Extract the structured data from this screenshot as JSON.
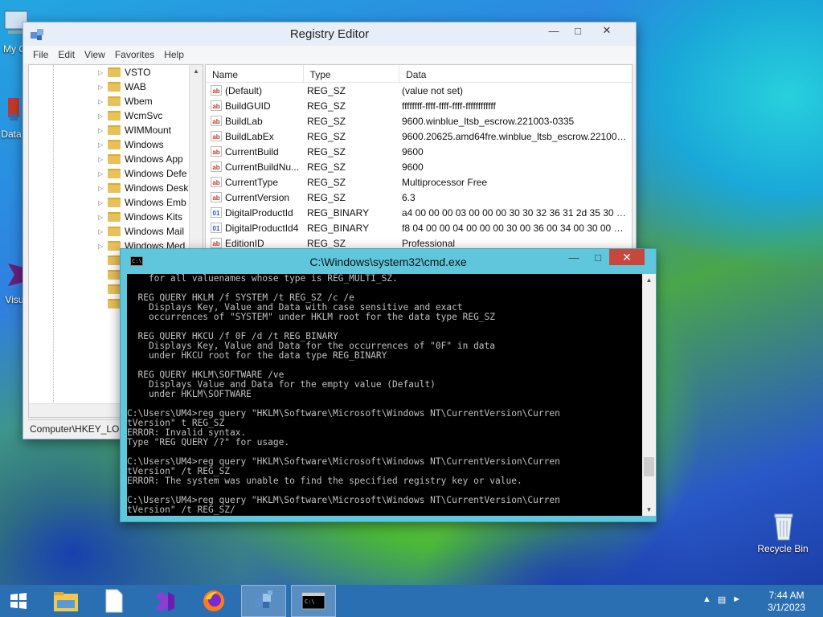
{
  "desktop": {
    "icons": [
      {
        "label": "My C"
      },
      {
        "label": "Data"
      },
      {
        "label": "Visu"
      },
      {
        "label": "Recycle Bin"
      }
    ]
  },
  "regedit": {
    "title": "Registry Editor",
    "menu": [
      "File",
      "Edit",
      "View",
      "Favorites",
      "Help"
    ],
    "tree_items": [
      "VSTO",
      "WAB",
      "Wbem",
      "WcmSvc",
      "WIMMount",
      "Windows",
      "Windows App",
      "Windows Defe",
      "Windows Desk",
      "Windows Emb",
      "Windows Kits",
      "Windows Mail",
      "Windows Med"
    ],
    "columns": [
      "Name",
      "Type",
      "Data"
    ],
    "values": [
      {
        "name": "(Default)",
        "type": "REG_SZ",
        "data": "(value not set)",
        "icon": "string-value-icon"
      },
      {
        "name": "BuildGUID",
        "type": "REG_SZ",
        "data": "ffffffff-ffff-ffff-ffff-ffffffffffff",
        "icon": "string-value-icon"
      },
      {
        "name": "BuildLab",
        "type": "REG_SZ",
        "data": "9600.winblue_ltsb_escrow.221003-0335",
        "icon": "string-value-icon"
      },
      {
        "name": "BuildLabEx",
        "type": "REG_SZ",
        "data": "9600.20625.amd64fre.winblue_ltsb_escrow.221003-...",
        "icon": "string-value-icon"
      },
      {
        "name": "CurrentBuild",
        "type": "REG_SZ",
        "data": "9600",
        "icon": "string-value-icon"
      },
      {
        "name": "CurrentBuildNu...",
        "type": "REG_SZ",
        "data": "9600",
        "icon": "string-value-icon"
      },
      {
        "name": "CurrentType",
        "type": "REG_SZ",
        "data": "Multiprocessor Free",
        "icon": "string-value-icon"
      },
      {
        "name": "CurrentVersion",
        "type": "REG_SZ",
        "data": "6.3",
        "icon": "string-value-icon"
      },
      {
        "name": "DigitalProductId",
        "type": "REG_BINARY",
        "data": "a4 00 00 00 03 00 00 00 30 30 32 36 31 2d 35 30 30 3...",
        "icon": "binary-value-icon"
      },
      {
        "name": "DigitalProductId4",
        "type": "REG_BINARY",
        "data": "f8 04 00 00 04 00 00 00 30 00 36 00 34 00 30 00 31 00...",
        "icon": "binary-value-icon"
      },
      {
        "name": "EditionID",
        "type": "REG_SZ",
        "data": "Professional",
        "icon": "string-value-icon"
      }
    ],
    "status": "Computer\\HKEY_LOC"
  },
  "cmd": {
    "title": "C:\\Windows\\system32\\cmd.exe",
    "output": "    for all valuenames whose type is REG_MULTI_SZ.\n\n  REG QUERY HKLM /f SYSTEM /t REG_SZ /c /e\n    Displays Key, Value and Data with case sensitive and exact\n    occurrences of \"SYSTEM\" under HKLM root for the data type REG_SZ\n\n  REG QUERY HKCU /f 0F /d /t REG_BINARY\n    Displays Key, Value and Data for the occurrences of \"0F\" in data\n    under HKCU root for the data type REG_BINARY\n\n  REG QUERY HKLM\\SOFTWARE /ve\n    Displays Value and Data for the empty value (Default)\n    under HKLM\\SOFTWARE\n\nC:\\Users\\UM4>reg query \"HKLM\\Software\\Microsoft\\Windows NT\\CurrentVersion\\Curren\ntVersion\" t REG_SZ\nERROR: Invalid syntax.\nType \"REG QUERY /?\" for usage.\n\nC:\\Users\\UM4>reg query \"HKLM\\Software\\Microsoft\\Windows NT\\CurrentVersion\\Curren\ntVersion\" /t REG_SZ\nERROR: The system was unable to find the specified registry key or value.\n\nC:\\Users\\UM4>reg query \"HKLM\\Software\\Microsoft\\Windows NT\\CurrentVersion\\Curren\ntVersion\" /t REG_SZ/"
  },
  "taskbar": {
    "time": "7:44 AM",
    "date": "3/1/2023",
    "items": [
      "start-button",
      "file-explorer",
      "notepad",
      "visual-studio",
      "firefox",
      "registry-editor",
      "command-prompt"
    ]
  }
}
